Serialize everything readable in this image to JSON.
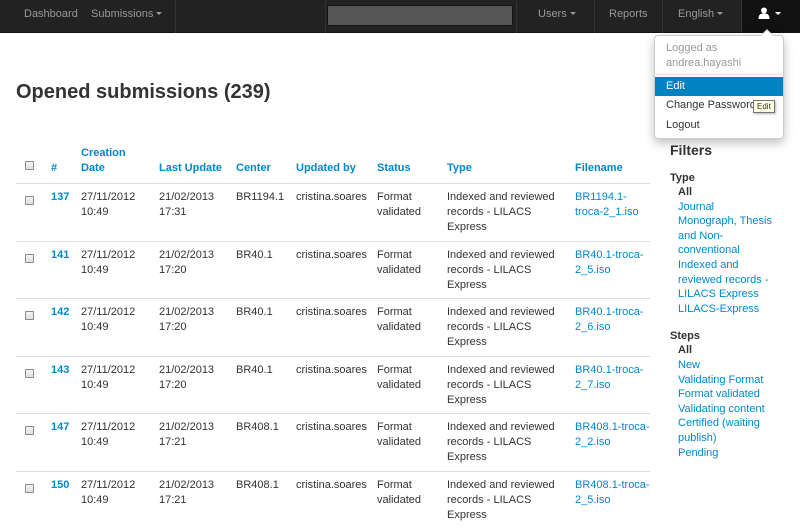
{
  "navbar": {
    "dashboard": "Dashboard",
    "submissions": "Submissions",
    "users": "Users",
    "reports": "Reports",
    "language": "English",
    "search_placeholder": "",
    "user_icon": "user-icon"
  },
  "user_menu": {
    "logged_as_label": "Logged as",
    "username": "andrea.hayashi",
    "items": [
      "Edit",
      "Change Password",
      "Logout"
    ],
    "tooltip": "Edit"
  },
  "page": {
    "title": "Opened submissions (239)"
  },
  "table": {
    "headers": [
      "#",
      "Creation Date",
      "Last Update",
      "Center",
      "Updated by",
      "Status",
      "Type",
      "Filename"
    ],
    "rows": [
      {
        "id": "137",
        "created_date": "27/11/2012",
        "created_time": "10:49",
        "updated_date": "21/02/2013",
        "updated_time": "17:31",
        "center": "BR1194.1",
        "updated_by": "cristina.soares",
        "status": [
          "Format",
          "validated"
        ],
        "type": [
          "Indexed and reviewed",
          "records - LILACS",
          "Express"
        ],
        "filename": [
          "BR1194.1-",
          "troca-2_1.iso"
        ]
      },
      {
        "id": "141",
        "created_date": "27/11/2012",
        "created_time": "10:49",
        "updated_date": "21/02/2013",
        "updated_time": "17:20",
        "center": "BR40.1",
        "updated_by": "cristina.soares",
        "status": [
          "Format",
          "validated"
        ],
        "type": [
          "Indexed and reviewed",
          "records - LILACS",
          "Express"
        ],
        "filename": [
          "BR40.1-troca-",
          "2_5.iso"
        ]
      },
      {
        "id": "142",
        "created_date": "27/11/2012",
        "created_time": "10:49",
        "updated_date": "21/02/2013",
        "updated_time": "17:20",
        "center": "BR40.1",
        "updated_by": "cristina.soares",
        "status": [
          "Format",
          "validated"
        ],
        "type": [
          "Indexed and reviewed",
          "records - LILACS",
          "Express"
        ],
        "filename": [
          "BR40.1-troca-",
          "2_6.iso"
        ]
      },
      {
        "id": "143",
        "created_date": "27/11/2012",
        "created_time": "10:49",
        "updated_date": "21/02/2013",
        "updated_time": "17:20",
        "center": "BR40.1",
        "updated_by": "cristina.soares",
        "status": [
          "Format",
          "validated"
        ],
        "type": [
          "Indexed and reviewed",
          "records - LILACS",
          "Express"
        ],
        "filename": [
          "BR40.1-troca-",
          "2_7.iso"
        ]
      },
      {
        "id": "147",
        "created_date": "27/11/2012",
        "created_time": "10:49",
        "updated_date": "21/02/2013",
        "updated_time": "17:21",
        "center": "BR408.1",
        "updated_by": "cristina.soares",
        "status": [
          "Format",
          "validated"
        ],
        "type": [
          "Indexed and reviewed",
          "records - LILACS",
          "Express"
        ],
        "filename": [
          "BR408.1-troca-",
          "2_2.iso"
        ]
      },
      {
        "id": "150",
        "created_date": "27/11/2012",
        "created_time": "10:49",
        "updated_date": "21/02/2013",
        "updated_time": "17:21",
        "center": "BR408.1",
        "updated_by": "cristina.soares",
        "status": [
          "Format",
          "validated"
        ],
        "type": [
          "Indexed and reviewed",
          "records - LILACS",
          "Express"
        ],
        "filename": [
          "BR408.1-troca-",
          "2_5.iso"
        ]
      }
    ]
  },
  "filters": {
    "title": "Filters",
    "type": {
      "label": "Type",
      "options": [
        "All",
        "Journal",
        "Monograph, Thesis",
        "and Non-",
        "conventional",
        "Indexed and",
        "reviewed records -",
        "LILACS Express",
        "LILACS-Express"
      ]
    },
    "steps": {
      "label": "Steps",
      "options": [
        "All",
        "New",
        "Validating Format",
        "Format validated",
        "Validating content",
        "Certified (waiting",
        "publish)",
        "Pending"
      ]
    }
  },
  "colors": {
    "navbar": "#222222",
    "link": "#0088cc",
    "active_item": "#0081c2"
  }
}
